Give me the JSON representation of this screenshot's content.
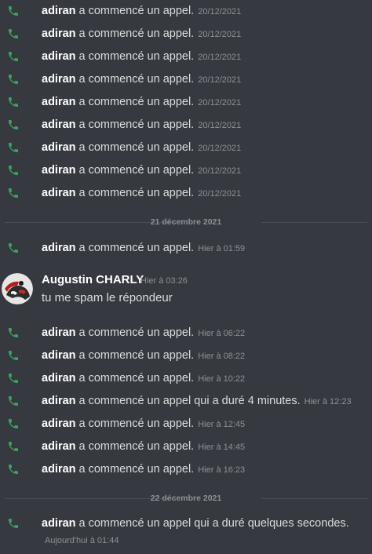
{
  "calls_top": [
    {
      "author": "adiran",
      "action": "a commencé un appel.",
      "time": "20/12/2021"
    },
    {
      "author": "adiran",
      "action": "a commencé un appel.",
      "time": "20/12/2021"
    },
    {
      "author": "adiran",
      "action": "a commencé un appel.",
      "time": "20/12/2021"
    },
    {
      "author": "adiran",
      "action": "a commencé un appel.",
      "time": "20/12/2021"
    },
    {
      "author": "adiran",
      "action": "a commencé un appel.",
      "time": "20/12/2021"
    },
    {
      "author": "adiran",
      "action": "a commencé un appel.",
      "time": "20/12/2021"
    },
    {
      "author": "adiran",
      "action": "a commencé un appel.",
      "time": "20/12/2021"
    },
    {
      "author": "adiran",
      "action": "a commencé un appel.",
      "time": "20/12/2021"
    },
    {
      "author": "adiran",
      "action": "a commencé un appel.",
      "time": "20/12/2021"
    }
  ],
  "dividers": [
    "21 décembre 2021",
    "22 décembre 2021"
  ],
  "call_dec21_first": {
    "author": "adiran",
    "action": "a commencé un appel.",
    "time": "Hier à 01:59"
  },
  "message": {
    "author": "Augustin CHARLY",
    "time": "Hier à 03:26",
    "text": "tu me spam le répondeur"
  },
  "calls_dec21": [
    {
      "author": "adiran",
      "action": "a commencé un appel.",
      "time": "Hier à 06:22"
    },
    {
      "author": "adiran",
      "action": "a commencé un appel.",
      "time": "Hier à 08:22"
    },
    {
      "author": "adiran",
      "action": "a commencé un appel.",
      "time": "Hier à 10:22"
    },
    {
      "author": "adiran",
      "action": "a commencé un appel qui a duré 4 minutes.",
      "time": "Hier à 12:23"
    },
    {
      "author": "adiran",
      "action": "a commencé un appel.",
      "time": "Hier à 12:45"
    },
    {
      "author": "adiran",
      "action": "a commencé un appel.",
      "time": "Hier à 14:45"
    },
    {
      "author": "adiran",
      "action": "a commencé un appel.",
      "time": "Hier à 16:23"
    }
  ],
  "call_dec22": {
    "author": "adiran",
    "action": "a commencé un appel qui a duré quelques secondes.",
    "time": "Aujourd'hui à 01:44"
  },
  "colors": {
    "background": "#36393f",
    "phone_icon": "#3ba55d",
    "author_text": "#ffffff",
    "body_text": "#dcddde",
    "muted_text": "#8e9297"
  },
  "icons": {
    "call": "phone-icon",
    "avatar": "user-avatar"
  }
}
